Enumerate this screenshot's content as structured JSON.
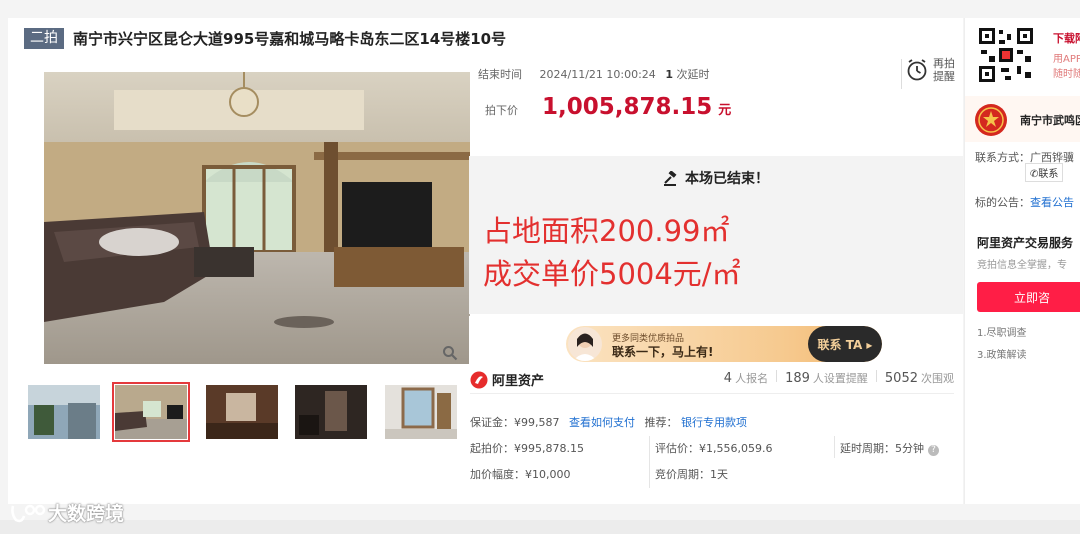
{
  "listing": {
    "round_badge": "二拍",
    "title": "南宁市兴宁区昆仑大道995号嘉和城马略卡岛东二区14号楼10号"
  },
  "auction": {
    "end_label": "结束时间",
    "end_time": "2024/11/21 10:00:24",
    "delay_count": "1",
    "delay_suffix": "次延时",
    "remind_label": "再拍提醒",
    "price_label": "拍下价",
    "price": "1,005,878.15",
    "price_unit": "元",
    "status": "本场已结束！",
    "overlay_line1": "占地面积200.99㎡",
    "overlay_line2": "成交单价5004元/㎡"
  },
  "promo": {
    "line1": "更多同类优质拍品",
    "line2": "联系一下，马上有!",
    "button": "联系 TA ▸"
  },
  "platform": {
    "name": "阿里资产",
    "registered_count": "4",
    "registered_label": "人报名",
    "reminder_count": "189",
    "reminder_label": "人设置提醒",
    "views_count": "5052",
    "views_label": "次围观"
  },
  "details": {
    "deposit": "保证金：¥99,587",
    "deposit_link": "查看如何支付",
    "recommend_label": "推荐：",
    "recommend_link": "银行专用款项",
    "start_price": "起拍价：¥995,878.15",
    "assessed_price": "评估价：¥1,556,059.6",
    "delay_period": "延时周期：5分钟",
    "increment": "加价幅度：¥10,000",
    "bid_period": "竞价周期：1天"
  },
  "right_panel": {
    "download_title": "下载阿",
    "download_line1": "用APP",
    "download_line2": "随时随",
    "court_name": "南宁市武鸣区",
    "contact_label": "联系方式：广西铧骥",
    "contact_button": "联系",
    "notice_label": "标的公告：",
    "notice_link": "查看公告",
    "service_title": "阿里资产交易服务",
    "service_sub": "竞拍信息全掌握，专",
    "consult_button": "立即咨",
    "list_item1": "1.尽职调查",
    "list_item3": "3.政策解读"
  },
  "watermark": {
    "text": "大数跨境"
  },
  "colors": {
    "price_red": "#c8102e",
    "overlay_red": "#e3302f",
    "link_blue": "#1f6fd0",
    "badge_gray": "#5b6b82",
    "consult_red": "#ff1e46"
  }
}
